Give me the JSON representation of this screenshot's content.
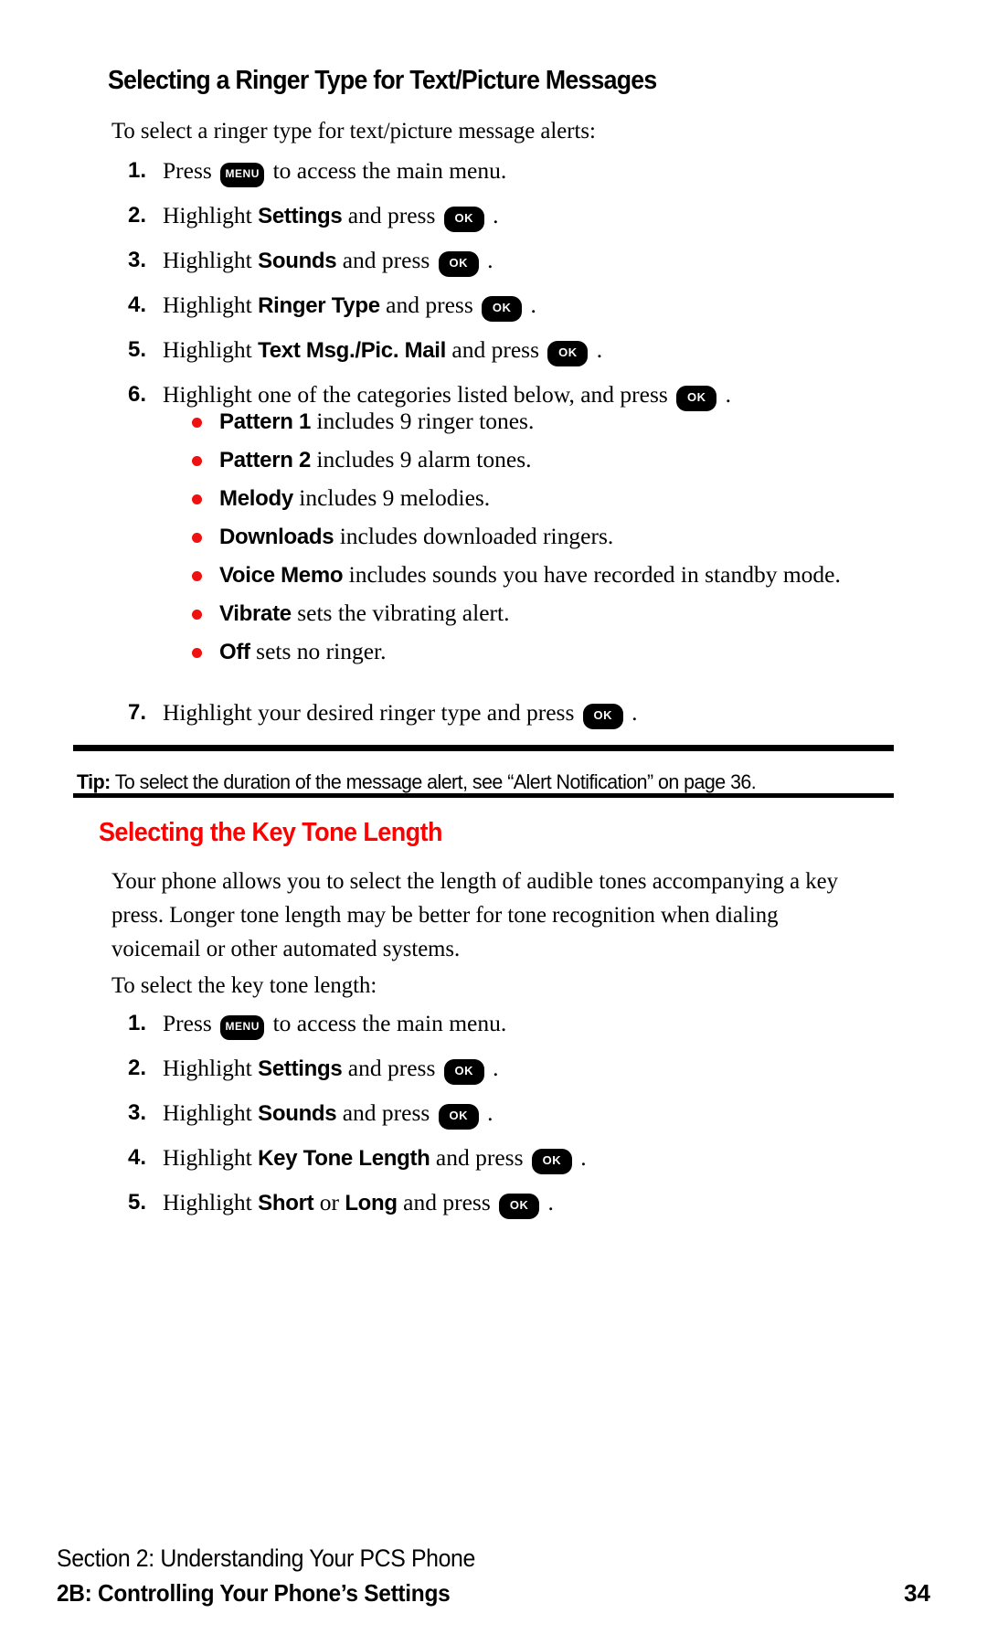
{
  "section1": {
    "heading": "Selecting a Ringer Type for Text/Picture Messages",
    "intro": "To select a ringer type for text/picture message alerts:",
    "steps": [
      {
        "num": "1.",
        "pre": "Press ",
        "key": "MENU",
        "post": " to access the main menu.",
        "bold": "",
        "mid": ""
      },
      {
        "num": "2.",
        "pre": "Highlight ",
        "bold": "Settings",
        "mid": " and press ",
        "key": "OK",
        "post": " ."
      },
      {
        "num": "3.",
        "pre": "Highlight ",
        "bold": "Sounds",
        "mid": " and press ",
        "key": "OK",
        "post": " ."
      },
      {
        "num": "4.",
        "pre": "Highlight ",
        "bold": "Ringer Type",
        "mid": " and press ",
        "key": "OK",
        "post": " ."
      },
      {
        "num": "5.",
        "pre": "Highlight ",
        "bold": "Text Msg./Pic. Mail",
        "mid": " and press ",
        "key": "OK",
        "post": " ."
      },
      {
        "num": "6.",
        "pre": "Highlight one of the categories listed below, and press ",
        "bold": "",
        "mid": "",
        "key": "OK",
        "post": " ."
      }
    ],
    "bullets": [
      {
        "term": "Pattern 1",
        "desc": " includes 9 ringer tones."
      },
      {
        "term": "Pattern 2",
        "desc": " includes 9 alarm tones."
      },
      {
        "term": "Melody",
        "desc": " includes 9 melodies."
      },
      {
        "term": "Downloads",
        "desc": " includes downloaded ringers."
      },
      {
        "term": "Voice Memo",
        "desc": " includes sounds you have recorded in standby mode."
      },
      {
        "term": "Vibrate",
        "desc": " sets the vibrating alert."
      },
      {
        "term": "Off",
        "desc": " sets no ringer."
      }
    ],
    "step7": {
      "num": "7.",
      "pre": "Highlight your desired ringer type and press ",
      "key": "OK",
      "post": " ."
    },
    "tip": {
      "label": "Tip:",
      "text": " To select the duration of the message alert, see “Alert Notification” on page 36."
    }
  },
  "section2": {
    "heading": "Selecting the Key Tone Length",
    "paragraph": "Your phone allows you to select the length of audible tones accompanying a key press. Longer tone length may be better for tone recognition when dialing voicemail or other automated systems.",
    "intro": "To select the key tone length:",
    "steps": [
      {
        "num": "1.",
        "pre": "Press ",
        "key": "MENU",
        "post": " to access the main menu.",
        "bold": "",
        "mid": ""
      },
      {
        "num": "2.",
        "pre": "Highlight ",
        "bold": "Settings",
        "mid": " and press ",
        "key": "OK",
        "post": " ."
      },
      {
        "num": "3.",
        "pre": "Highlight ",
        "bold": "Sounds",
        "mid": " and press ",
        "key": "OK",
        "post": " ."
      },
      {
        "num": "4.",
        "pre": "Highlight ",
        "bold": "Key Tone Length",
        "mid": " and press ",
        "key": "OK",
        "post": " ."
      },
      {
        "num": "5.",
        "pre": "Highlight ",
        "bold": "Short",
        "mid2": " or ",
        "bold2": "Long",
        "mid": " and press ",
        "key": "OK",
        "post": " ."
      }
    ]
  },
  "footer": {
    "line1": "Section 2: Understanding Your PCS Phone",
    "line2": "2B: Controlling Your Phone’s Settings",
    "page": "34"
  },
  "colors": {
    "accent_red": "#ff0000",
    "bullet_red": "#ee1111",
    "text_black": "#000000",
    "background": "#ffffff"
  }
}
